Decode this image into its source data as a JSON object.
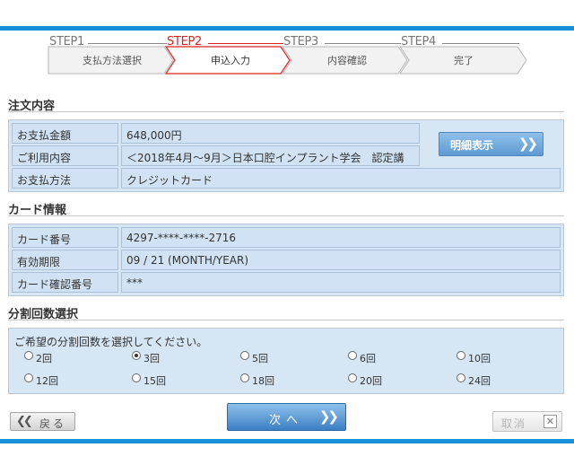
{
  "steps": [
    {
      "title": "STEP1",
      "label": "支払方法選択",
      "active": false
    },
    {
      "title": "STEP2",
      "label": "申込入力",
      "active": true
    },
    {
      "title": "STEP3",
      "label": "内容確認",
      "active": false
    },
    {
      "title": "STEP4",
      "label": "完了",
      "active": false
    }
  ],
  "order": {
    "section_title": "注文内容",
    "rows": [
      {
        "label": "お支払金額",
        "value": "648,000円"
      },
      {
        "label": "ご利用内容",
        "value": "＜2018年4月～9月＞日本口腔インプラント学会　認定講"
      },
      {
        "label": "お支払方法",
        "value": "クレジットカード"
      }
    ],
    "detail_button": "明細表示"
  },
  "card": {
    "section_title": "カード情報",
    "rows": [
      {
        "label": "カード番号",
        "value": "4297-****-****-2716"
      },
      {
        "label": "有効期限",
        "value": "09 / 21 (MONTH/YEAR)"
      },
      {
        "label": "カード確認番号",
        "value": "***"
      }
    ]
  },
  "installments": {
    "section_title": "分割回数選択",
    "prompt": "ご希望の分割回数を選択してください。",
    "options": [
      "2回",
      "3回",
      "5回",
      "6回",
      "10回",
      "12回",
      "15回",
      "18回",
      "20回",
      "24回"
    ],
    "selected": "3回"
  },
  "buttons": {
    "back": "戻る",
    "next": "次へ",
    "cancel": "取消"
  },
  "colors": {
    "accent_blue": "#1a8fdc",
    "active_step": "#e02020",
    "panel_bg": "#d6e6f5"
  }
}
